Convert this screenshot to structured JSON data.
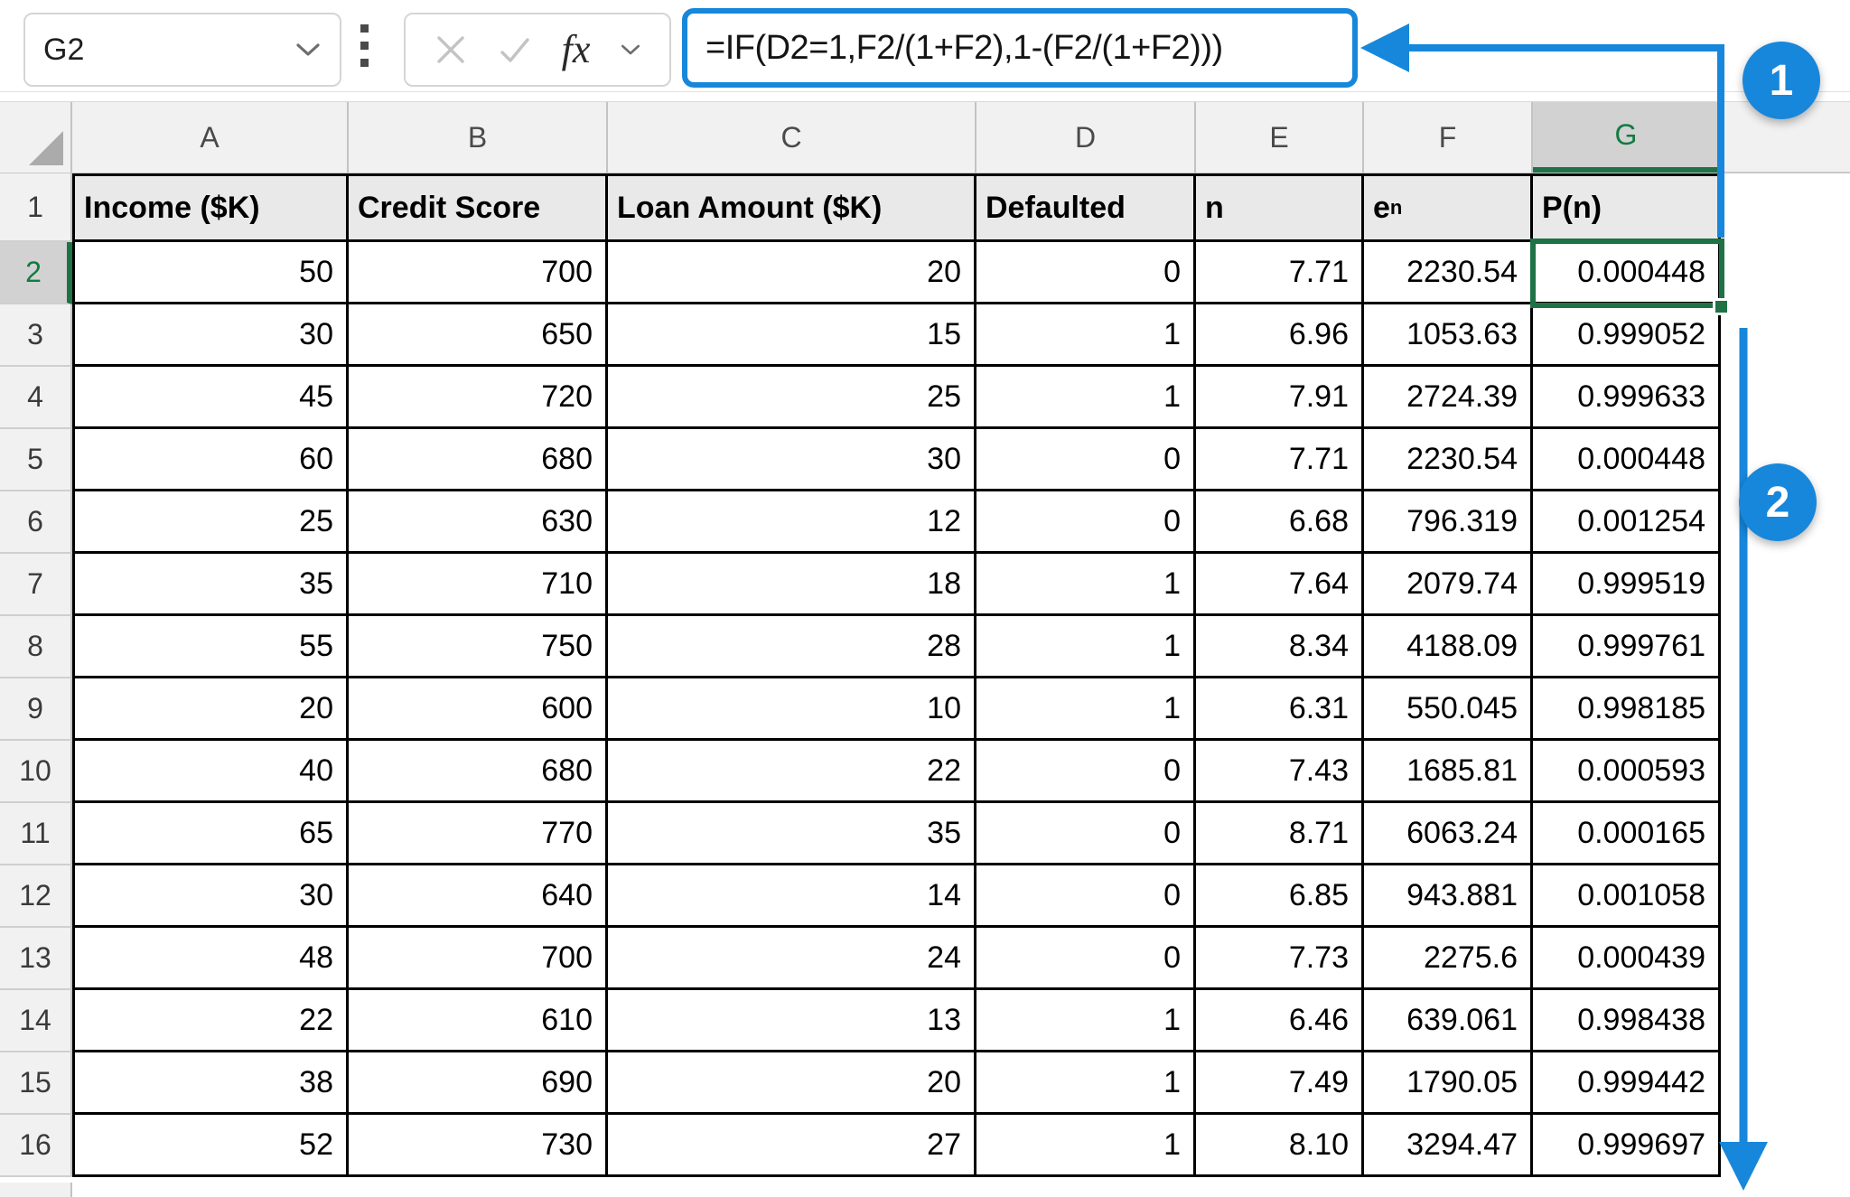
{
  "formula_bar": {
    "name_box_value": "G2",
    "formula": "=IF(D2=1,F2/(1+F2),1-(F2/(1+F2)))",
    "insert_function_label": "fx"
  },
  "icons": {
    "name_box_dropdown": "chevron-down-icon",
    "formula_cancel": "x-icon",
    "formula_enter": "check-icon",
    "insert_function": "fx-icon",
    "formula_bar_separator": "vertical-dots-icon",
    "select_all": "corner-triangle-icon",
    "callout_1_arrow": "arrow-left-then-down-icon",
    "callout_2_arrow": "arrow-down-icon"
  },
  "sheet": {
    "selected_cell": "G2",
    "selected_column": "G",
    "selected_row": "2",
    "column_letters": [
      "A",
      "B",
      "C",
      "D",
      "E",
      "F",
      "G"
    ],
    "header_row": {
      "row_num": "1",
      "cells": [
        "Income ($K)",
        "Credit Score",
        "Loan Amount ($K)",
        "Defaulted",
        "n",
        "e^n",
        "P(n)"
      ]
    },
    "rows": [
      {
        "row_num": "2",
        "cells": [
          "50",
          "700",
          "20",
          "0",
          "7.71",
          "2230.54",
          "0.000448"
        ]
      },
      {
        "row_num": "3",
        "cells": [
          "30",
          "650",
          "15",
          "1",
          "6.96",
          "1053.63",
          "0.999052"
        ]
      },
      {
        "row_num": "4",
        "cells": [
          "45",
          "720",
          "25",
          "1",
          "7.91",
          "2724.39",
          "0.999633"
        ]
      },
      {
        "row_num": "5",
        "cells": [
          "60",
          "680",
          "30",
          "0",
          "7.71",
          "2230.54",
          "0.000448"
        ]
      },
      {
        "row_num": "6",
        "cells": [
          "25",
          "630",
          "12",
          "0",
          "6.68",
          "796.319",
          "0.001254"
        ]
      },
      {
        "row_num": "7",
        "cells": [
          "35",
          "710",
          "18",
          "1",
          "7.64",
          "2079.74",
          "0.999519"
        ]
      },
      {
        "row_num": "8",
        "cells": [
          "55",
          "750",
          "28",
          "1",
          "8.34",
          "4188.09",
          "0.999761"
        ]
      },
      {
        "row_num": "9",
        "cells": [
          "20",
          "600",
          "10",
          "1",
          "6.31",
          "550.045",
          "0.998185"
        ]
      },
      {
        "row_num": "10",
        "cells": [
          "40",
          "680",
          "22",
          "0",
          "7.43",
          "1685.81",
          "0.000593"
        ]
      },
      {
        "row_num": "11",
        "cells": [
          "65",
          "770",
          "35",
          "0",
          "8.71",
          "6063.24",
          "0.000165"
        ]
      },
      {
        "row_num": "12",
        "cells": [
          "30",
          "640",
          "14",
          "0",
          "6.85",
          "943.881",
          "0.001058"
        ]
      },
      {
        "row_num": "13",
        "cells": [
          "48",
          "700",
          "24",
          "0",
          "7.73",
          "2275.6",
          "0.000439"
        ]
      },
      {
        "row_num": "14",
        "cells": [
          "22",
          "610",
          "13",
          "1",
          "6.46",
          "639.061",
          "0.998438"
        ]
      },
      {
        "row_num": "15",
        "cells": [
          "38",
          "690",
          "20",
          "1",
          "7.49",
          "1790.05",
          "0.999442"
        ]
      },
      {
        "row_num": "16",
        "cells": [
          "52",
          "730",
          "27",
          "1",
          "8.10",
          "3294.47",
          "0.999697"
        ]
      }
    ]
  },
  "annotations": {
    "badge_1": "1",
    "badge_2": "2"
  },
  "colors": {
    "annotation_blue": "#1787db",
    "selection_green": "#1f7246",
    "selected_header_text_green": "#107c41",
    "grid_border_black": "#000000",
    "header_fill_gray": "#e9e9e9",
    "chrome_gray": "#f1f1f1"
  }
}
